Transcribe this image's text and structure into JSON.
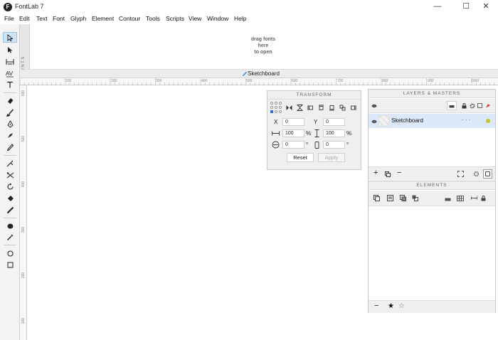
{
  "window": {
    "title": "FontLab 7",
    "logo_letter": "F",
    "minimize_glyph": "—",
    "maximize_glyph": "☐",
    "close_glyph": "✕"
  },
  "menu": [
    "File",
    "Edit",
    "Text",
    "Font",
    "Glyph",
    "Element",
    "Contour",
    "Tools",
    "Scripts",
    "View",
    "Window",
    "Help"
  ],
  "fonts_panel": {
    "tab_label": "FONTS",
    "drop_hint": [
      "drag fonts",
      "here",
      "to open"
    ]
  },
  "tab": {
    "title": "Sketchboard"
  },
  "ruler": {
    "horizontal": [
      "100",
      "200",
      "300",
      "400",
      "500",
      "600",
      "700",
      "800",
      "900",
      "1000"
    ],
    "vertical": [
      "600",
      "500",
      "400",
      "300",
      "200",
      "100"
    ]
  },
  "transform": {
    "title": "TRANSFORM",
    "x_label": "X",
    "x_value": "0",
    "y_label": "Y",
    "y_value": "0",
    "w_value": "100",
    "w_unit": "%",
    "h_value": "100",
    "h_unit": "%",
    "rotate_value": "0",
    "rotate_unit": "°",
    "slant_value": "0",
    "slant_unit": "°",
    "reset_label": "Reset",
    "apply_label": "Apply"
  },
  "layers": {
    "title": "LAYERS & MASTERS",
    "rows": [
      {
        "name": "Sketchboard",
        "dash_marks": "-  -  -"
      }
    ],
    "add_glyph": "+",
    "remove_glyph": "−"
  },
  "elements": {
    "title": "ELEMENTS",
    "remove_glyph": "−",
    "star_filled": "★",
    "star_empty": "☆"
  },
  "colors": {
    "selected_row": "#dce9fb",
    "tool_selected": "#cde3f7",
    "layer_dot": "#c9c220"
  }
}
